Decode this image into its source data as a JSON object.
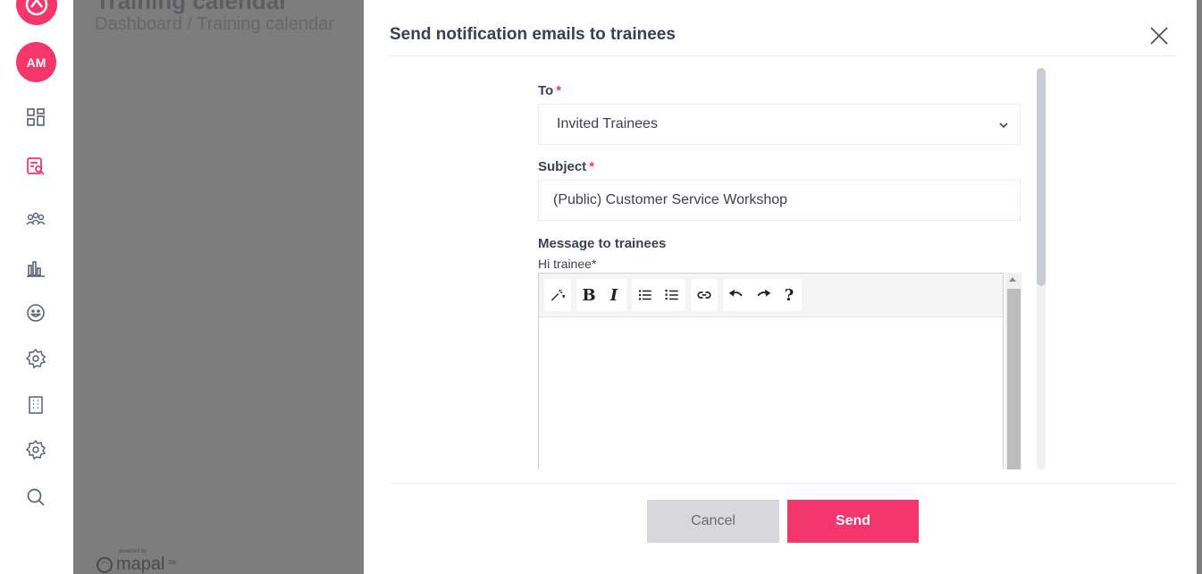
{
  "rail": {
    "avatar_initials": "AM",
    "icons": [
      "logo-icon",
      "dashboard-icon",
      "training-calendar-icon",
      "people-icon",
      "reports-icon",
      "emoji-icon",
      "settings-icon",
      "building-icon",
      "settings-icon",
      "search-icon"
    ]
  },
  "background": {
    "page_title": "Training calendar",
    "breadcrumb": "Dashboard  /  Training calendar",
    "footer_powered": "powered by",
    "footer_brand": "mapal",
    "footer_brand_suffix": "os"
  },
  "modal": {
    "title": "Send notification emails to trainees",
    "to_label": "To",
    "to_value": "Invited Trainees",
    "subject_label": "Subject",
    "subject_value": "(Public) Customer Service Workshop",
    "message_label": "Message to trainees",
    "greeting_label": "Hi trainee*",
    "toolbar": {
      "bold": "B",
      "italic": "I",
      "help": "?"
    },
    "cancel_label": "Cancel",
    "send_label": "Send"
  },
  "colors": {
    "accent": "#f4366c",
    "backdrop": "#7d7d7d",
    "text": "#3c3f58"
  }
}
